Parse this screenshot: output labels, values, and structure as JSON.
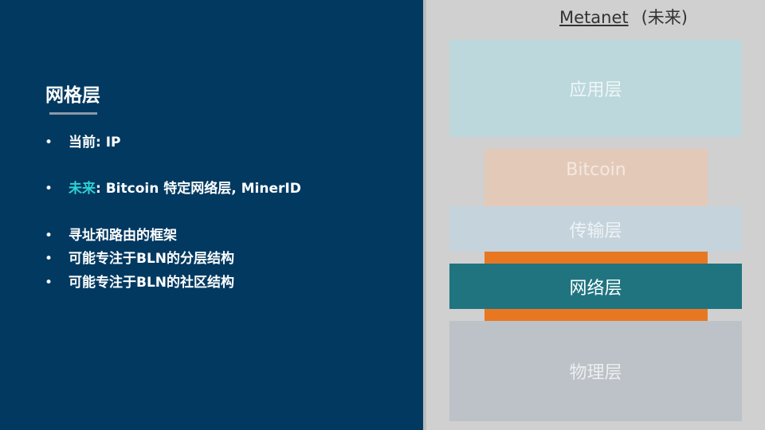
{
  "left": {
    "title": "网格层",
    "bullets": [
      {
        "dot": "•",
        "prefix": "",
        "text": "当前: IP"
      },
      {
        "dot": "•",
        "prefix": "未来",
        "text": ": Bitcoin 特定网络层, MinerID"
      },
      {
        "dot": "•",
        "prefix": "",
        "text": "寻址和路由的框架"
      },
      {
        "dot": "•",
        "prefix": "",
        "text": "可能专注于BLN的分层结构"
      },
      {
        "dot": "•",
        "prefix": "",
        "text": "可能专注于BLN的社区结构"
      }
    ]
  },
  "diagram": {
    "header_main": "Metanet",
    "header_suffix": "(未来)",
    "layers": {
      "application": "应用层",
      "bitcoin": "Bitcoin",
      "transport": "传输层",
      "network": "网络层",
      "physical": "物理层"
    }
  },
  "colors": {
    "left_bg": "#013961",
    "accent": "#2fd0d6",
    "application": "#bcd8dc",
    "bitcoin": "#e3c9b8",
    "transport": "#c5d3dc",
    "network": "#1f7480",
    "network_frame": "#e87722",
    "physical": "#bcc2c7"
  }
}
